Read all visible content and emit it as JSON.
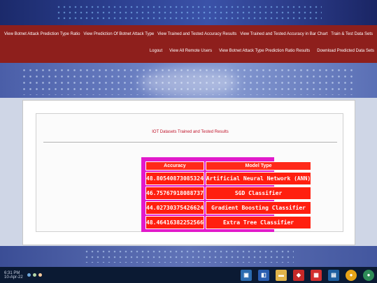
{
  "nav": {
    "row1": [
      "View Botnet Attack Prediction Type Ratio",
      "View Prediction Of Botnet Attack Type",
      "View Trained and Tested Accuracy Results",
      "View Trained and Tested Accuracy in Bar Chart",
      "Train & Test Data Sets"
    ],
    "row2": [
      "Logout",
      "View All Remote Users",
      "View Botnet Attack Type Prediction Ratio Results",
      "Download Predicted Data Sets"
    ]
  },
  "panel": {
    "title": "IOT Datasets Trained and Tested Results",
    "headers": {
      "accuracy": "Accuracy",
      "model": "Model Type"
    },
    "rows": [
      {
        "accuracy": "48.80540873085324",
        "model": "Artificial Neural Network (ANN)"
      },
      {
        "accuracy": "46.75767918088737",
        "model": "SGD Classifier"
      },
      {
        "accuracy": "44.02730375426624",
        "model": "Gradient Boosting Classifier"
      },
      {
        "accuracy": "48.46416382252566",
        "model": "Extra Tree Classifier"
      }
    ]
  },
  "taskbar": {
    "time": "6:31 PM",
    "date": "10-Apr-22"
  },
  "colors": {
    "nav_bg": "#8e1f1c",
    "title_red": "#c0152b",
    "table_frame": "#e21acb",
    "cell_red": "#ff1f0f"
  }
}
